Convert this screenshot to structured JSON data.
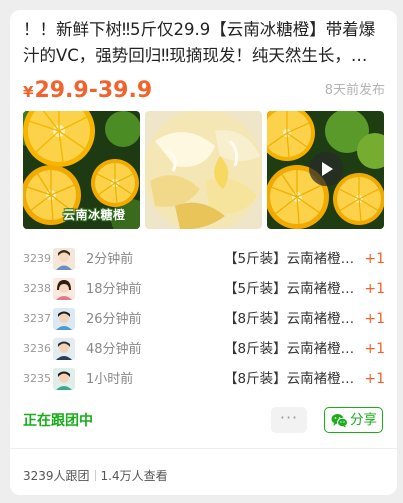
{
  "post": {
    "title": "！！新鲜下树‼5斤仅29.9【云南冰糖橙】带着爆汁的VC，强势回归‼现摘现发！纯天然生长，…",
    "price_symbol": "¥",
    "price_range": "29.9-39.9",
    "published": "8天前发布",
    "image_label": "云南冰糖橙"
  },
  "orders": [
    {
      "num": "3239",
      "time": "2分钟前",
      "product": "【5斤装】云南褚橙…",
      "qty": "+1"
    },
    {
      "num": "3238",
      "time": "18分钟前",
      "product": "【5斤装】云南褚橙…",
      "qty": "+1"
    },
    {
      "num": "3237",
      "time": "26分钟前",
      "product": "【8斤装】云南褚橙…",
      "qty": "+1"
    },
    {
      "num": "3236",
      "time": "48分钟前",
      "product": "【8斤装】云南褚橙…",
      "qty": "+1"
    },
    {
      "num": "3235",
      "time": "1小时前",
      "product": "【8斤装】云南褚橙…",
      "qty": "+1"
    }
  ],
  "actions": {
    "status": "正在跟团中",
    "more": "···",
    "share": "分享"
  },
  "footer": {
    "joined": "3239人跟团",
    "views": "1.4万人查看"
  },
  "colors": {
    "price": "#f2632c",
    "accent_green": "#1aad19"
  }
}
